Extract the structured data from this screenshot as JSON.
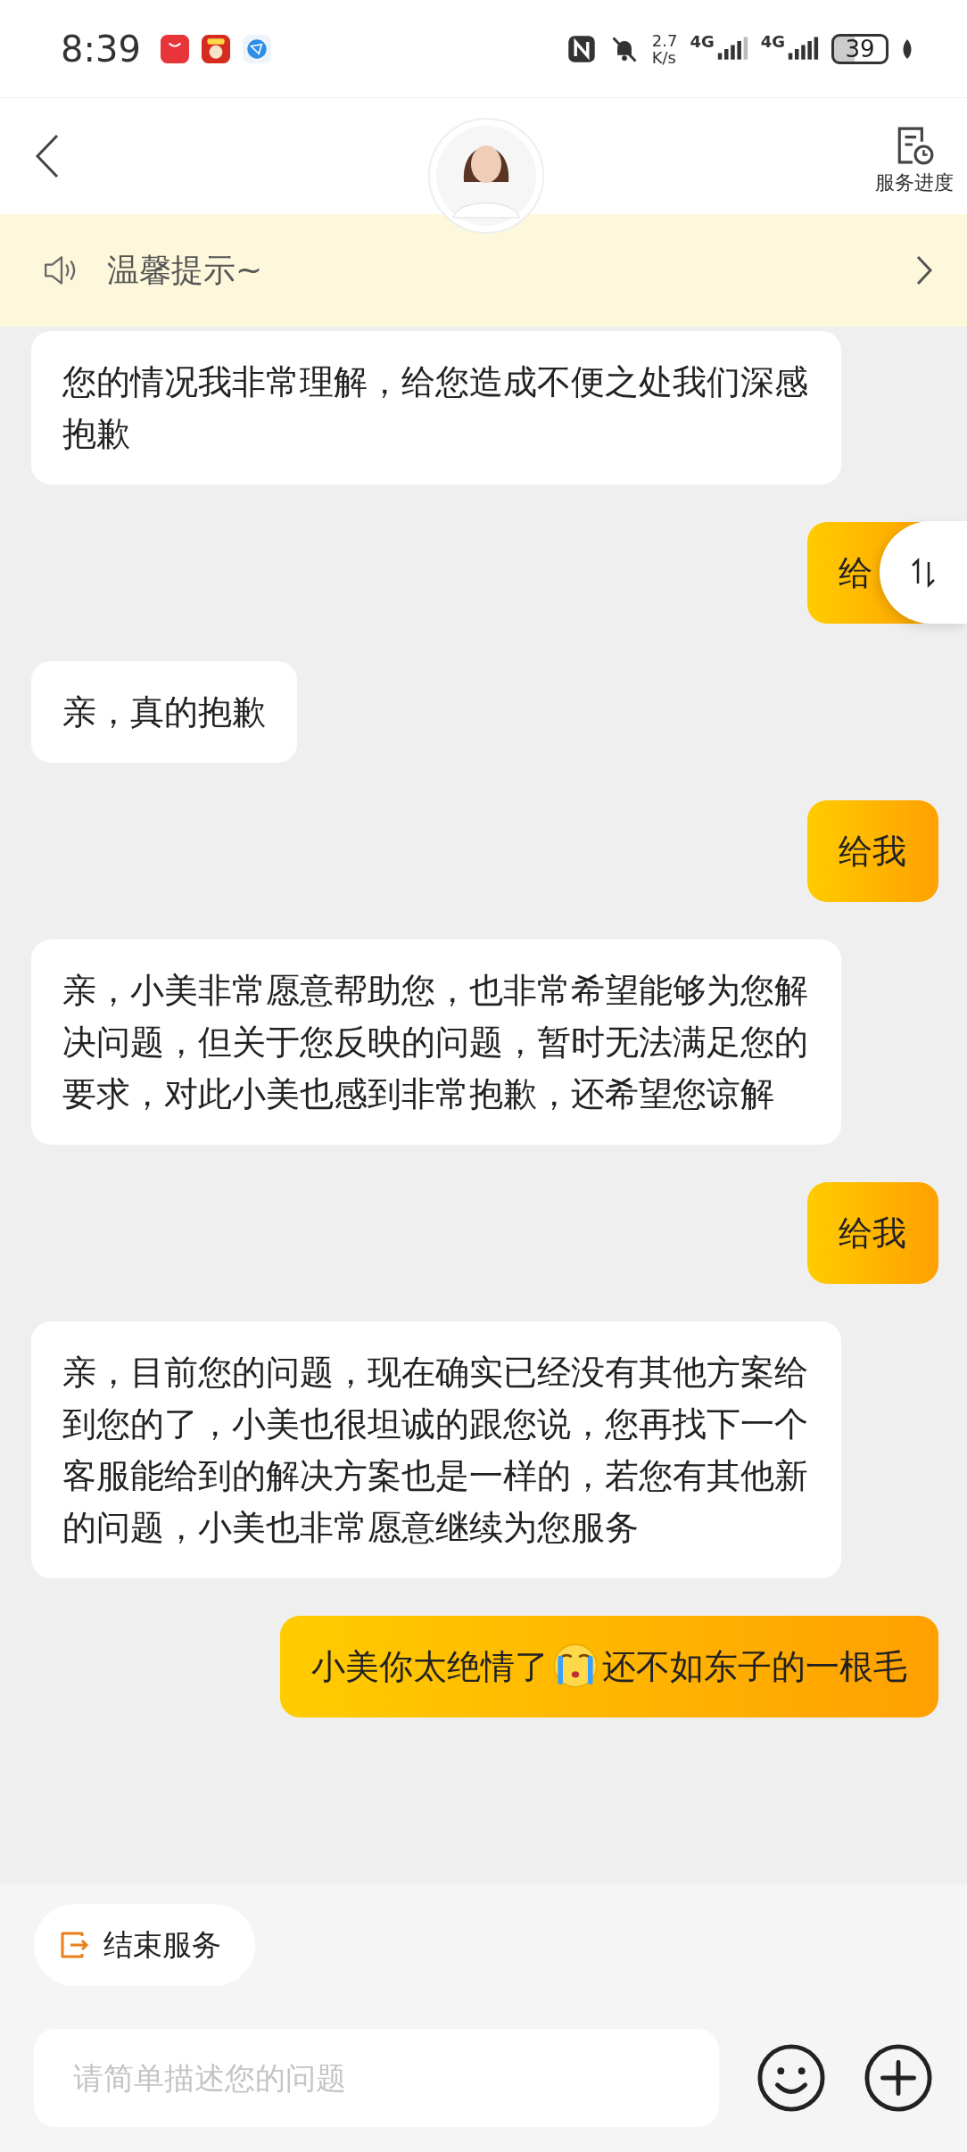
{
  "status_bar": {
    "time": "8:39",
    "speed_value": "2.7",
    "speed_unit": "K/s",
    "network_1": "4G",
    "network_2": "4G",
    "battery": "39"
  },
  "header": {
    "progress_label": "服务进度"
  },
  "notice": {
    "text": "温馨提示~"
  },
  "messages": [
    {
      "kind": "agent",
      "segments": [
        {
          "kind": "text",
          "text": "您的情况我非常理解，给您造成不便之处我们深感抱歉"
        }
      ]
    },
    {
      "kind": "user",
      "segments": [
        {
          "kind": "text",
          "text": "给"
        }
      ]
    },
    {
      "kind": "agent",
      "segments": [
        {
          "kind": "text",
          "text": "亲，真的抱歉"
        }
      ]
    },
    {
      "kind": "user",
      "segments": [
        {
          "kind": "text",
          "text": "给我"
        }
      ]
    },
    {
      "kind": "agent",
      "segments": [
        {
          "kind": "text",
          "text": "亲，小美非常愿意帮助您，也非常希望能够为您解决问题，但关于您反映的问题，暂时无法满足您的要求，对此小美也感到非常抱歉，还希望您谅解"
        }
      ]
    },
    {
      "kind": "user",
      "segments": [
        {
          "kind": "text",
          "text": "给我"
        }
      ]
    },
    {
      "kind": "agent",
      "segments": [
        {
          "kind": "text",
          "text": "亲，目前您的问题，现在确实已经没有其他方案给到您的了，小美也很坦诚的跟您说，您再找下一个客服能给到的解决方案也是一样的，若您有其他新的问题，小美也非常愿意继续为您服务"
        }
      ]
    },
    {
      "kind": "user",
      "segments": [
        {
          "kind": "text",
          "text": "小美你太绝情了"
        },
        {
          "kind": "emoji"
        },
        {
          "kind": "text",
          "text": "还不如东子的一根毛"
        }
      ]
    }
  ],
  "end_service": {
    "label": "结束服务"
  },
  "input": {
    "placeholder": "请简单描述您的问题"
  }
}
